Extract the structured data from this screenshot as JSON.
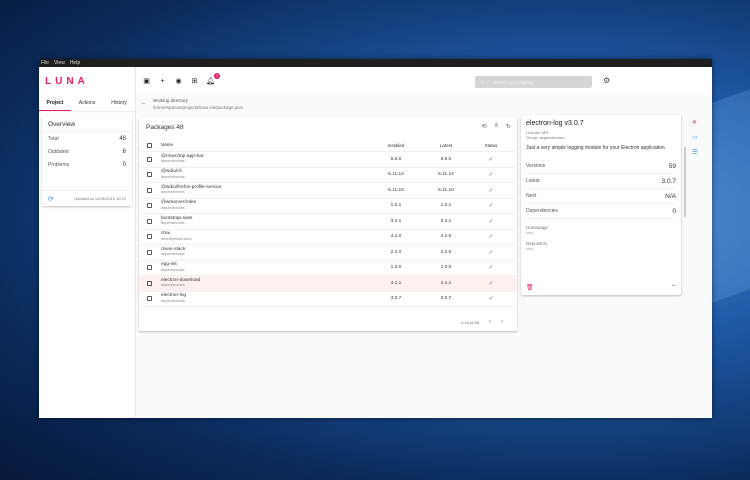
{
  "menubar": [
    "File",
    "View",
    "Help"
  ],
  "app": {
    "logo": "LUNA"
  },
  "sidebar": {
    "tabs": [
      {
        "label": "Project",
        "active": true
      },
      {
        "label": "Actions",
        "active": false
      },
      {
        "label": "History",
        "active": false
      }
    ],
    "overview": {
      "title": "Overview",
      "rows": [
        {
          "label": "Total",
          "value": "48"
        },
        {
          "label": "Outdated",
          "value": "6"
        },
        {
          "label": "Problems",
          "value": "0"
        }
      ],
      "updated": "Updated at 12/06/2019 10:24"
    }
  },
  "topbar": {
    "notification_count": "3",
    "search_placeholder": "Search npm registry",
    "icons": [
      "folder-open-icon",
      "add-icon",
      "globe-icon",
      "add-box-icon",
      "notifications-icon",
      "settings-icon"
    ]
  },
  "working_directory": {
    "label": "Working directory",
    "path": "/home/spanos/projects/luna-init/package.json"
  },
  "packages": {
    "title": "Packages 48",
    "columns": [
      "Name",
      "Installed",
      "Latest",
      "Status"
    ],
    "rows": [
      {
        "name": "@rmwc/top-app-bar",
        "group": "dependencies",
        "installed": "5.6.0",
        "latest": "5.6.0",
        "selected": false
      },
      {
        "name": "@wdio/cli",
        "group": "dependencies",
        "installed": "5.11.14",
        "latest": "5.11.14",
        "selected": false
      },
      {
        "name": "@wdio/firefox-profile-service",
        "group": "dependencies",
        "installed": "5.11.10",
        "latest": "5.11.10",
        "selected": false
      },
      {
        "name": "@wrserver/roles",
        "group": "dependencies",
        "installed": "1.0.1",
        "latest": "1.0.1",
        "selected": false
      },
      {
        "name": "bootstrap-sass",
        "group": "dependencies",
        "installed": "3.4.1",
        "latest": "3.4.1",
        "selected": false
      },
      {
        "name": "chai",
        "group": "devDependencies",
        "installed": "4.2.0",
        "latest": "4.2.0",
        "selected": false
      },
      {
        "name": "clean-stack",
        "group": "dependencies",
        "installed": "2.2.0",
        "latest": "2.2.0",
        "selected": false
      },
      {
        "name": "egg-init",
        "group": "dependencies",
        "installed": "1.0.0",
        "latest": "1.0.0",
        "selected": false
      },
      {
        "name": "electron-download",
        "group": "dependencies",
        "installed": "4.1.1",
        "latest": "4.1.1",
        "selected": true
      },
      {
        "name": "electron-log",
        "group": "dependencies",
        "installed": "3.0.7",
        "latest": "3.0.7",
        "selected": false
      }
    ],
    "pagination": "1-10 of 48"
  },
  "details": {
    "title": "electron-log v3.0.7",
    "license": "License: MIT",
    "group": "Group: dependencies",
    "description": "Just a very simple logging module for your Electron application",
    "stats": [
      {
        "label": "Versions",
        "value": "59"
      },
      {
        "label": "Latest",
        "value": "3.0.7"
      },
      {
        "label": "Next",
        "value": "N/A"
      },
      {
        "label": "Dependencies",
        "value": "0"
      }
    ],
    "homepage_label": "Homepage",
    "homepage": "visit",
    "repository_label": "Repository",
    "repository": "visit"
  }
}
